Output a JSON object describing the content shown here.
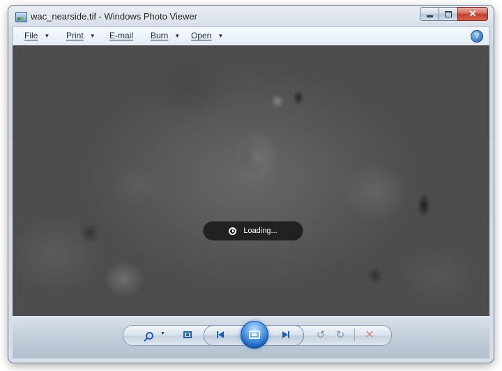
{
  "window": {
    "title": "wac_nearside.tif - Windows Photo Viewer",
    "controls": {
      "minimize_icon": "minimize-icon",
      "maximize_icon": "maximize-icon",
      "close_glyph": "✕"
    }
  },
  "menu": {
    "items": [
      {
        "label": "File",
        "has_dropdown": true
      },
      {
        "label": "Print",
        "has_dropdown": true
      },
      {
        "label": "E-mail",
        "has_dropdown": false
      },
      {
        "label": "Burn",
        "has_dropdown": true
      },
      {
        "label": "Open",
        "has_dropdown": true
      }
    ],
    "dropdown_glyph": "▼",
    "help_glyph": "?"
  },
  "viewer": {
    "image_description_icon": "lunar-surface-image",
    "loading_text": "Loading..."
  },
  "toolbar": {
    "icons": [
      "zoom-icon",
      "actual-size-icon",
      "previous-icon",
      "slideshow-icon",
      "next-icon",
      "rotate-counterclockwise-icon",
      "rotate-clockwise-icon",
      "delete-icon"
    ],
    "zoom_caret": "▼",
    "rotate_ccw_glyph": "↺",
    "rotate_cw_glyph": "↻",
    "delete_glyph": "✕"
  },
  "colors": {
    "accent_blue": "#1f5fb0",
    "close_red": "#c94a36",
    "loading_pill": "#191919"
  }
}
